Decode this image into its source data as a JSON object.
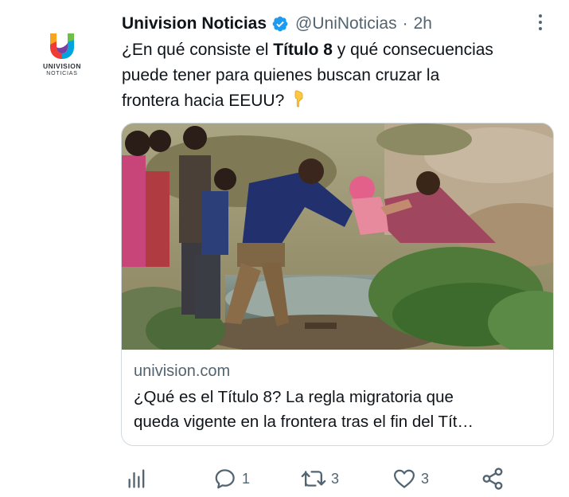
{
  "tweet": {
    "avatar_logo_word": "UNIVISION",
    "avatar_logo_sub": "NOTICIAS",
    "display_name": "Univision Noticias",
    "verified_icon": "verified-badge-icon",
    "handle": "@UniNoticias",
    "separator": "·",
    "time": "2h",
    "text_before": "¿En qué consiste el ",
    "text_bold": "Título 8",
    "text_after_line1": " y qué consecuencias",
    "text_line2": "puede tener para quienes buscan cruzar la",
    "text_line3": "frontera hacia EEUU?",
    "emoji_icon": "backhand-index-pointing-down-icon"
  },
  "card": {
    "image_icon": "photo-migrants-crossing-river",
    "domain": "univision.com",
    "title_line1": "¿Qué es el Título 8? La regla migratoria que",
    "title_line2": "queda vigente en la frontera tras el fin del Tít…"
  },
  "actions": {
    "views_icon": "analytics-icon",
    "reply_icon": "reply-icon",
    "reply_count": "1",
    "retweet_icon": "retweet-icon",
    "retweet_count": "3",
    "like_icon": "heart-icon",
    "like_count": "3",
    "share_icon": "share-icon"
  },
  "colors": {
    "text_primary": "#0f1419",
    "text_secondary": "#536471",
    "border": "#cfd9de",
    "verified_blue": "#1d9bf0"
  }
}
